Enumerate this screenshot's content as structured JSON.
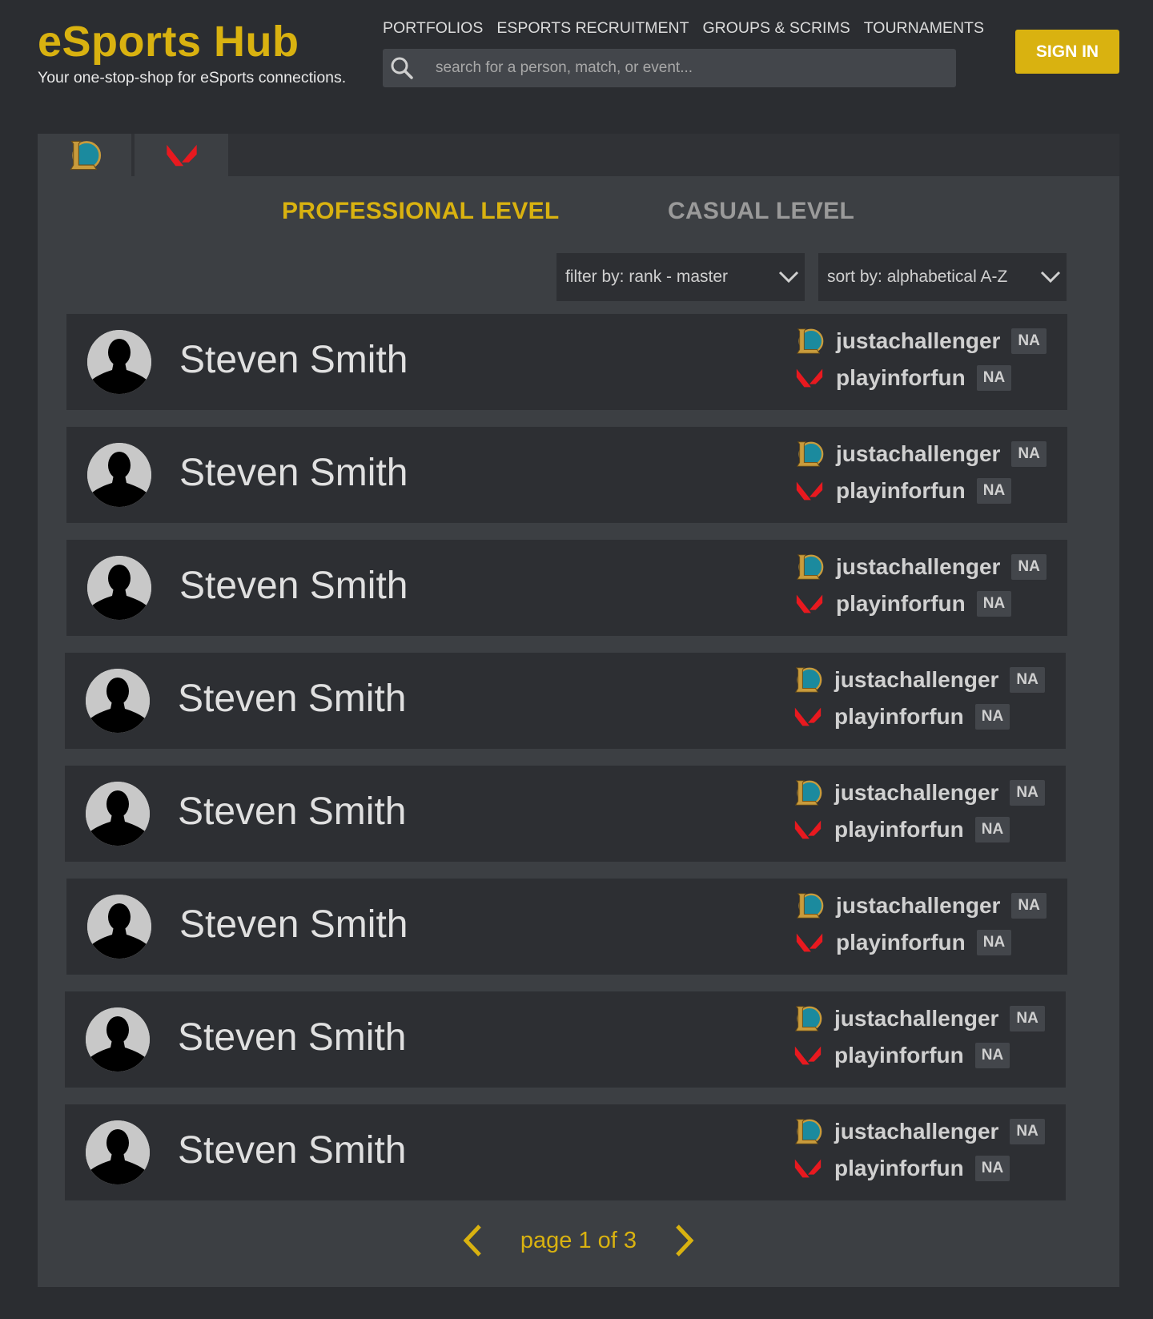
{
  "brand": {
    "title": "eSports Hub",
    "tagline": "Your one-stop-shop for eSports connections."
  },
  "nav": [
    {
      "label": "PORTFOLIOS"
    },
    {
      "label": "ESPORTS RECRUITMENT"
    },
    {
      "label": "GROUPS & SCRIMS"
    },
    {
      "label": "TOURNAMENTS"
    }
  ],
  "search": {
    "placeholder": "search for a person, match, or event..."
  },
  "signin": {
    "label": "SIGN IN"
  },
  "game_tabs": [
    {
      "icon": "league-of-legends-icon"
    },
    {
      "icon": "valorant-icon"
    }
  ],
  "level_tabs": {
    "professional": "PROFESSIONAL LEVEL",
    "casual": "CASUAL LEVEL"
  },
  "filter": {
    "label": "filter by: rank - master"
  },
  "sort": {
    "label": "sort by: alphabetical A-Z"
  },
  "players": [
    {
      "name": "Steven Smith",
      "lol_username": "justachallenger",
      "lol_region": "NA",
      "val_username": "playinforfun",
      "val_region": "NA"
    },
    {
      "name": "Steven Smith",
      "lol_username": "justachallenger",
      "lol_region": "NA",
      "val_username": "playinforfun",
      "val_region": "NA"
    },
    {
      "name": "Steven Smith",
      "lol_username": "justachallenger",
      "lol_region": "NA",
      "val_username": "playinforfun",
      "val_region": "NA"
    },
    {
      "name": "Steven Smith",
      "lol_username": "justachallenger",
      "lol_region": "NA",
      "val_username": "playinforfun",
      "val_region": "NA"
    },
    {
      "name": "Steven Smith",
      "lol_username": "justachallenger",
      "lol_region": "NA",
      "val_username": "playinforfun",
      "val_region": "NA"
    },
    {
      "name": "Steven Smith",
      "lol_username": "justachallenger",
      "lol_region": "NA",
      "val_username": "playinforfun",
      "val_region": "NA"
    },
    {
      "name": "Steven Smith",
      "lol_username": "justachallenger",
      "lol_region": "NA",
      "val_username": "playinforfun",
      "val_region": "NA"
    },
    {
      "name": "Steven Smith",
      "lol_username": "justachallenger",
      "lol_region": "NA",
      "val_username": "playinforfun",
      "val_region": "NA"
    }
  ],
  "pagination": {
    "text": "page 1 of 3"
  },
  "colors": {
    "accent": "#d9b210",
    "background": "#2b2d31",
    "panel": "#3c3f43",
    "row": "#2d2f33",
    "valorant_red": "#e8191f"
  }
}
